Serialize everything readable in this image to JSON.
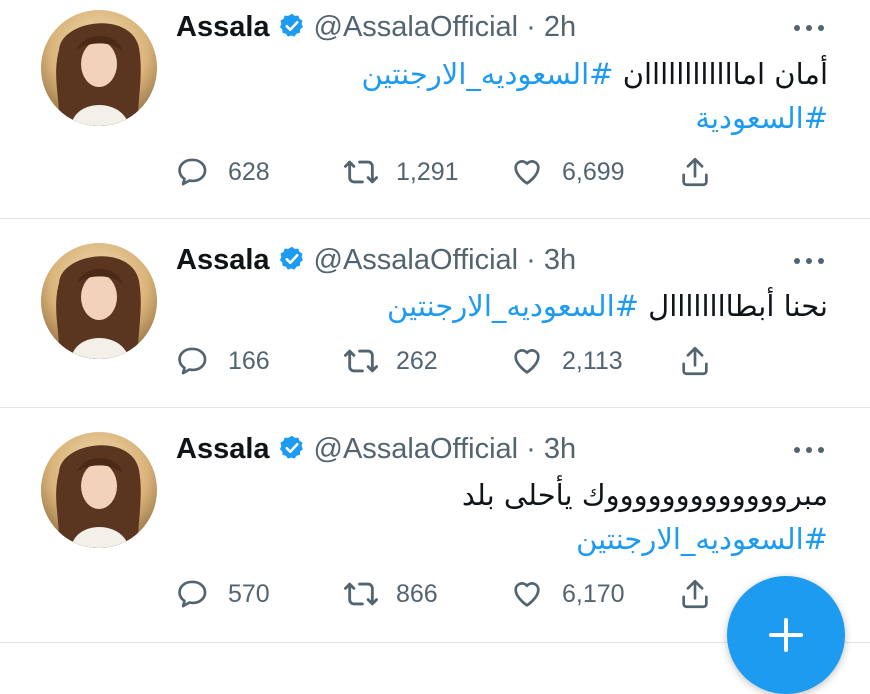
{
  "tweets": [
    {
      "name": "Assala",
      "handle": "@AssalaOfficial",
      "time": "· 2h",
      "text_plain": "أمان اماااااااااااان ",
      "text_tag1": "#السعوديه_الارجنتين",
      "text_tag2": "#السعودية",
      "replies": "628",
      "retweets": "1,291",
      "likes": "6,699"
    },
    {
      "name": "Assala",
      "handle": "@AssalaOfficial",
      "time": "· 3h",
      "text_plain": "نحنا أبطاااااااال ",
      "text_tag1": "#السعوديه_الارجنتين",
      "replies": "166",
      "retweets": "262",
      "likes": "2,113"
    },
    {
      "name": "Assala",
      "handle": "@AssalaOfficial",
      "time": "· 3h",
      "text_plain": "مبروووووووووووووك يأحلى بلد",
      "text_tag1": "#السعوديه_الارجنتين",
      "replies": "570",
      "retweets": "866",
      "likes": "6,170"
    }
  ],
  "icons": {
    "reply": "reply-icon",
    "retweet": "retweet-icon",
    "like": "heart-icon",
    "share": "share-icon",
    "more": "more-icon",
    "verified": "verified-badge-icon",
    "compose": "plus-icon"
  },
  "colors": {
    "accent": "#1d9bf0",
    "secondary_text": "#536471",
    "divider": "#e1e6ea"
  }
}
